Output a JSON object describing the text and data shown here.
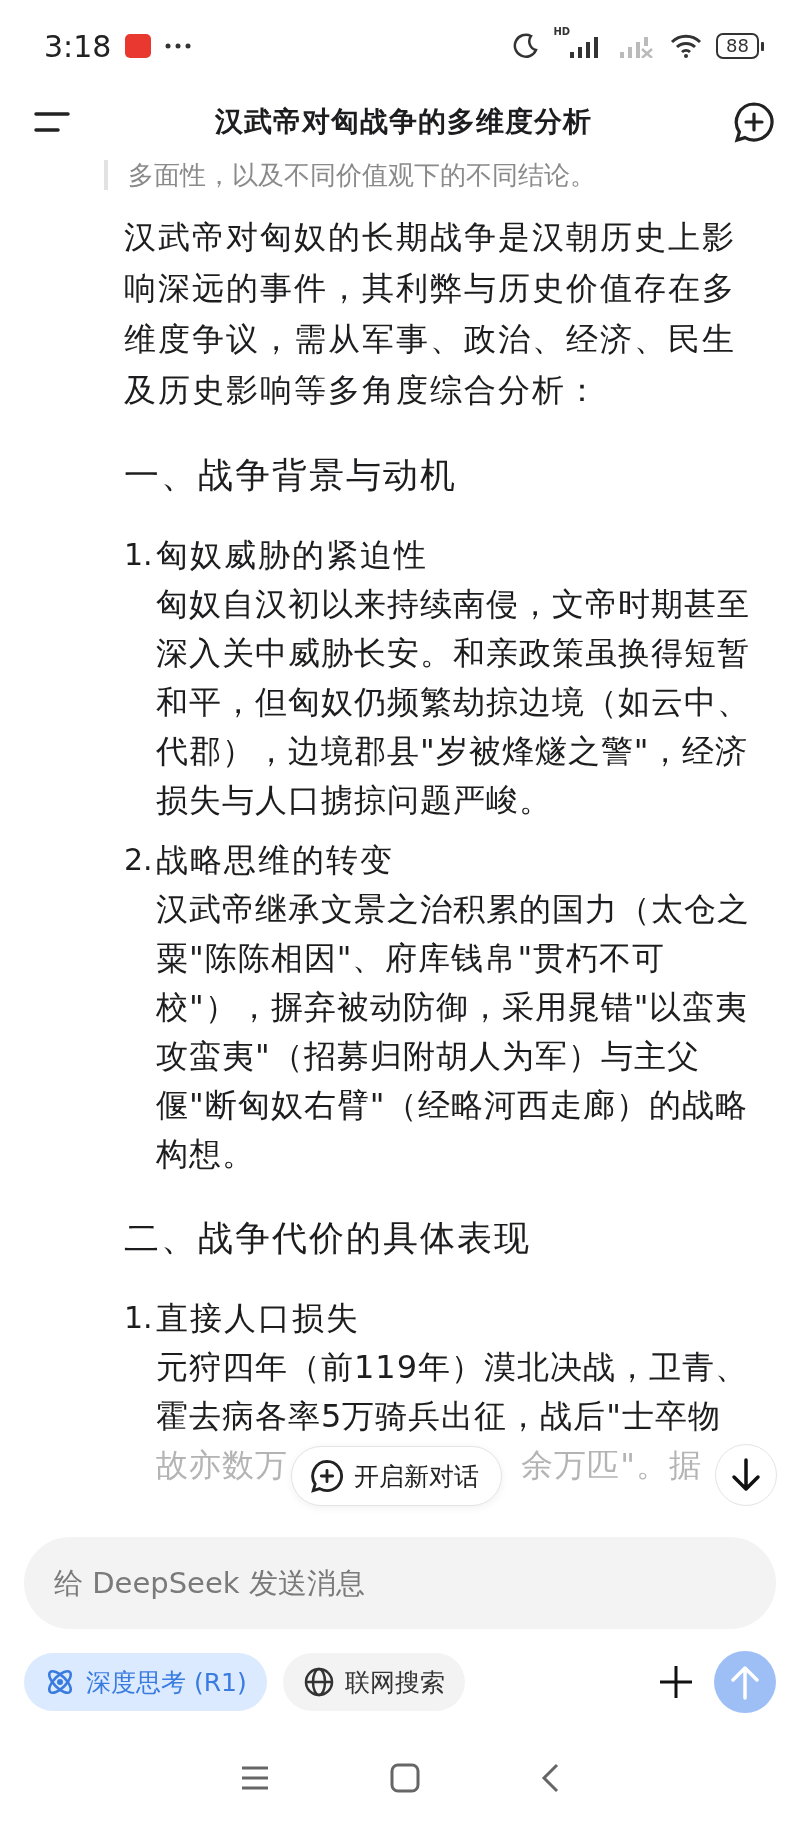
{
  "status_bar": {
    "time": "3:18",
    "network_label": "HD",
    "battery": "88"
  },
  "header": {
    "title": "汉武帝对匈战争的多维度分析"
  },
  "quote": "多面性，以及不同价值观下的不同结论。",
  "intro": "汉武帝对匈奴的长期战争是汉朝历史上影响深远的事件，其利弊与历史价值存在多维度争议，需从军事、政治、经济、民生及历史影响等多角度综合分析：",
  "sections": [
    {
      "heading": "一、战争背景与动机",
      "items": [
        {
          "number": "1.",
          "title": "匈奴威胁的紧迫性",
          "body": "匈奴自汉初以来持续南侵，文帝时期甚至深入关中威胁长安。和亲政策虽换得短暂和平，但匈奴仍频繁劫掠边境（如云中、代郡），边境郡县\"岁被烽燧之警\"，经济损失与人口掳掠问题严峻。"
        },
        {
          "number": "2.",
          "title": "战略思维的转变",
          "body": "汉武帝继承文景之治积累的国力（太仓之粟\"陈陈相因\"、府库钱帛\"贯朽不可校\"），摒弃被动防御，采用晁错\"以蛮夷攻蛮夷\"（招募归附胡人为军）与主父偃\"断匈奴右臂\"（经略河西走廊）的战略构想。"
        }
      ]
    },
    {
      "heading": "二、战争代价的具体表现",
      "items": [
        {
          "number": "1.",
          "title": "直接人口损失",
          "body": "元狩四年（前119年）漠北决战，卫青、霍去病各率5万骑兵出征，战后\"士卒物"
        }
      ]
    }
  ],
  "cut_line": {
    "left": "故亦数万",
    "right": "余万匹\"。据"
  },
  "new_chat_button": {
    "label": "开启新对话"
  },
  "composer": {
    "placeholder": "给 DeepSeek 发送消息"
  },
  "toggles": [
    {
      "kind": "think",
      "label": "深度思考 (R1)",
      "selected": true
    },
    {
      "kind": "search",
      "label": "联网搜索",
      "selected": false
    }
  ],
  "send_button": {
    "disabled": true
  }
}
